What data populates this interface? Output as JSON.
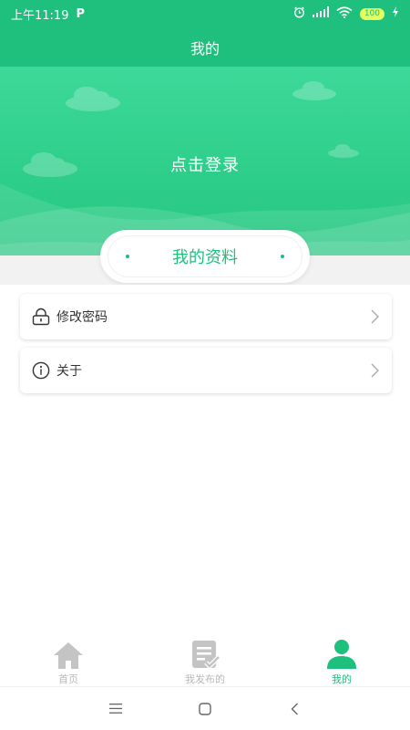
{
  "status_bar": {
    "time": "上午11:19",
    "app_indicator": "P",
    "battery": "100",
    "icons": [
      "alarm-icon",
      "signal-icon",
      "wifi-icon",
      "battery-icon",
      "charging-icon"
    ]
  },
  "header": {
    "title": "我的"
  },
  "hero": {
    "login_text": "点击登录"
  },
  "profile_section": {
    "title": "我的资料"
  },
  "menu": {
    "items": [
      {
        "label": "修改密码",
        "icon": "lock-icon"
      },
      {
        "label": "关于",
        "icon": "info-icon"
      }
    ]
  },
  "tab_bar": {
    "tabs": [
      {
        "label": "首页",
        "icon": "home-icon",
        "active": false
      },
      {
        "label": "我发布的",
        "icon": "published-doc-icon",
        "active": false
      },
      {
        "label": "我的",
        "icon": "user-icon",
        "active": true
      }
    ]
  },
  "system_nav": {
    "icons": [
      "menu-icon",
      "home-square-icon",
      "back-icon"
    ]
  },
  "colors": {
    "accent": "#1fbf7d",
    "tab_inactive": "#b8b8b8"
  }
}
